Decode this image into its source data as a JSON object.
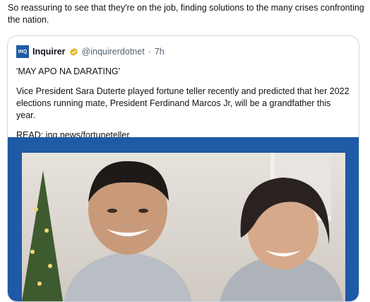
{
  "tweet": {
    "text": "So reassuring to see that they're on the job, finding solutions to the many crises confronting the nation."
  },
  "quote": {
    "logo_text": "INQ",
    "display_name": "Inquirer",
    "handle": "@inquirerdotnet",
    "separator": "·",
    "time": "7h",
    "headline": "'MAY APO NA DARATING'",
    "body": "Vice President Sara Duterte played fortune teller recently and predicted that her 2022 elections running mate, President Ferdinand Marcos Jr, will be a grandfather this year.",
    "read_more": "READ: inq.news/fortuneteller"
  },
  "colors": {
    "brand_blue": "#1f5aa6",
    "verified_gold": "#e2b719",
    "muted_text": "#536471",
    "border": "#cfd9de"
  },
  "icons": {
    "verified": "verified-badge-icon",
    "logo": "inquirer-logo-icon"
  }
}
